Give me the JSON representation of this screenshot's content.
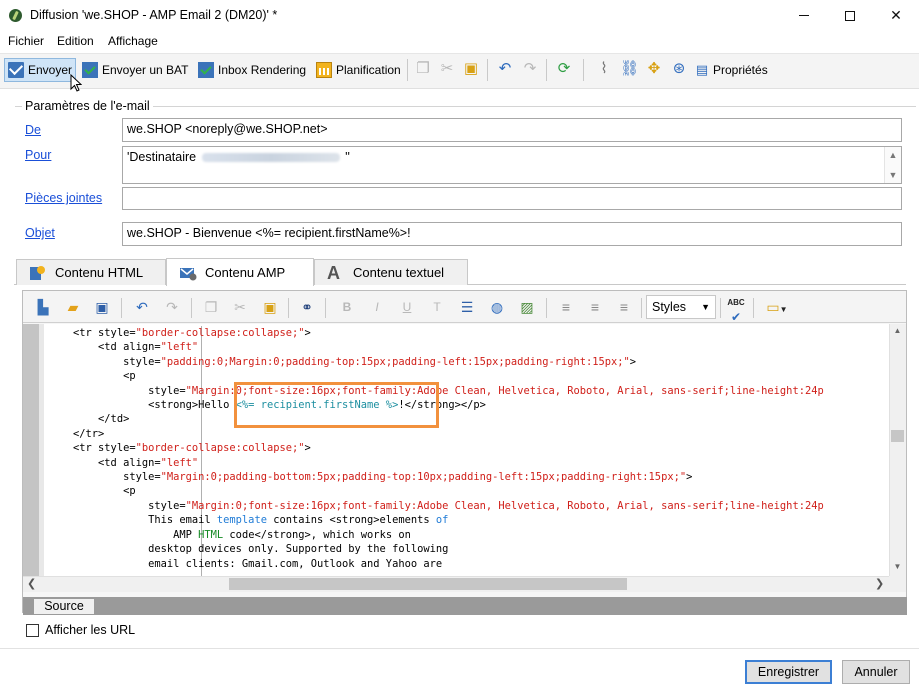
{
  "window": {
    "title": "Diffusion 'we.SHOP - AMP Email 2 (DM20)' *"
  },
  "menu": {
    "items": [
      "Fichier",
      "Edition",
      "Affichage"
    ]
  },
  "toolbar": {
    "send": "Envoyer",
    "proof": "Envoyer un BAT",
    "inbox": "Inbox Rendering",
    "schedule": "Planification",
    "properties": "Propriétés"
  },
  "params": {
    "legend": "Paramètres de l'e-mail",
    "from_label": "De",
    "from_value": "we.SHOP <noreply@we.SHOP.net>",
    "to_label": "Pour",
    "to_prefix": "'Destinataire",
    "to_suffix": "''",
    "attachments_label": "Pièces jointes",
    "attachments_value": "",
    "subject_label": "Objet",
    "subject_value": "we.SHOP - Bienvenue <%= recipient.firstName%>!"
  },
  "tabs": {
    "html": "Contenu HTML",
    "amp": "Contenu AMP",
    "text": "Contenu textuel"
  },
  "editor": {
    "styles_label": "Styles",
    "source_tab": "Source"
  },
  "footer": {
    "show_urls": "Afficher les URL",
    "save": "Enregistrer",
    "cancel": "Annuler"
  },
  "colors": {
    "highlight_box": "#f2913d",
    "link": "#1a4fd8",
    "code_string": "#d0201a",
    "code_keyword": "#1f7bd6"
  }
}
